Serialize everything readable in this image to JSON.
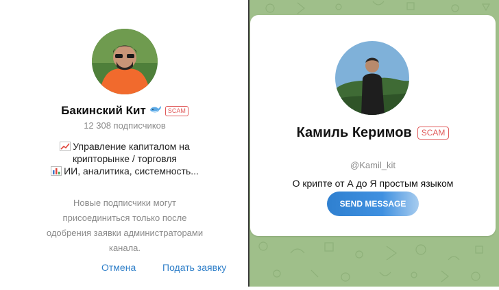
{
  "left_dialog": {
    "channel_name": "Бакинский Кит",
    "scam_label": "SCAM",
    "subscribers": "12 308 подписчиков",
    "description_line1": "Управление капиталом на",
    "description_line2": "крипторынке / торговля",
    "description_line3": "ИИ, аналитика, системность...",
    "notice_text": "Новые подписчики могут присоединиться только после одобрения заявки администраторами канала.",
    "cancel_label": "Отмена",
    "apply_label": "Подать заявку"
  },
  "right_card": {
    "name": "Камиль Керимов",
    "scam_label": "SCAM",
    "username": "@Kamil_kit",
    "about": "О крипте от А до Я простым языком",
    "send_label": "SEND MESSAGE"
  },
  "colors": {
    "accent": "#2f7fc9",
    "scam": "#e05a5a",
    "chat_background": "#9fbf8a",
    "button_gradient_start": "#2f80d0",
    "button_gradient_end": "#a7ccef"
  },
  "icons": {
    "whale_icon": "whale-emoji",
    "chart_up_icon": "chart-increasing-emoji",
    "bar_chart_icon": "bar-chart-emoji"
  }
}
